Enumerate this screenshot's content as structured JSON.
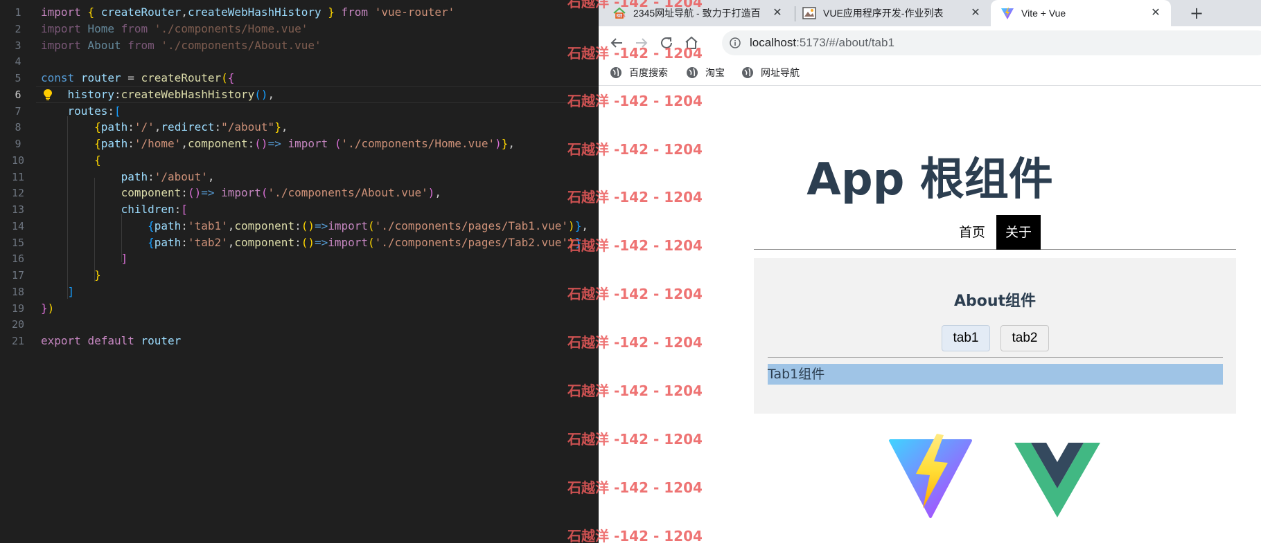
{
  "editor": {
    "active_line": 6,
    "lines": [
      {
        "n": "1",
        "tokens": [
          [
            "kw",
            "import"
          ],
          [
            "plain",
            " "
          ],
          [
            "br1",
            "{"
          ],
          [
            "plain",
            " "
          ],
          [
            "var",
            "createRouter"
          ],
          [
            "plain",
            ","
          ],
          [
            "var",
            "createWebHashHistory"
          ],
          [
            "plain",
            " "
          ],
          [
            "br1",
            "}"
          ],
          [
            "plain",
            " "
          ],
          [
            "kw",
            "from"
          ],
          [
            "plain",
            " "
          ],
          [
            "str",
            "'vue-router'"
          ]
        ]
      },
      {
        "n": "2",
        "tokens": [
          [
            "kw dim",
            "import"
          ],
          [
            "plain dim",
            " "
          ],
          [
            "var dim",
            "Home"
          ],
          [
            "plain dim",
            " "
          ],
          [
            "kw dim",
            "from"
          ],
          [
            "plain dim",
            " "
          ],
          [
            "str dim",
            "'./components/Home.vue'"
          ]
        ]
      },
      {
        "n": "3",
        "tokens": [
          [
            "kw dim",
            "import"
          ],
          [
            "plain dim",
            " "
          ],
          [
            "var dim",
            "About"
          ],
          [
            "plain dim",
            " "
          ],
          [
            "kw dim",
            "from"
          ],
          [
            "plain dim",
            " "
          ],
          [
            "str dim",
            "'./components/About.vue'"
          ]
        ]
      },
      {
        "n": "4",
        "tokens": []
      },
      {
        "n": "5",
        "tokens": [
          [
            "kw2",
            "const"
          ],
          [
            "plain",
            " "
          ],
          [
            "var",
            "router"
          ],
          [
            "plain",
            " = "
          ],
          [
            "fn",
            "createRouter"
          ],
          [
            "br1",
            "("
          ],
          [
            "br2",
            "{"
          ]
        ]
      },
      {
        "n": "6",
        "tokens": [
          [
            "plain",
            "    "
          ],
          [
            "prop",
            "history"
          ],
          [
            "plain",
            ":"
          ],
          [
            "fn",
            "createWebHashHistory"
          ],
          [
            "br3",
            "()"
          ],
          [
            "plain",
            ","
          ]
        ]
      },
      {
        "n": "7",
        "tokens": [
          [
            "plain",
            "    "
          ],
          [
            "prop",
            "routes"
          ],
          [
            "plain",
            ":"
          ],
          [
            "br3",
            "["
          ]
        ]
      },
      {
        "n": "8",
        "tokens": [
          [
            "plain",
            "        "
          ],
          [
            "br1",
            "{"
          ],
          [
            "prop",
            "path"
          ],
          [
            "plain",
            ":"
          ],
          [
            "str",
            "'/'"
          ],
          [
            "plain",
            ","
          ],
          [
            "prop",
            "redirect"
          ],
          [
            "plain",
            ":"
          ],
          [
            "str",
            "\"/about\""
          ],
          [
            "br1",
            "}"
          ],
          [
            "plain",
            ","
          ]
        ]
      },
      {
        "n": "9",
        "tokens": [
          [
            "plain",
            "        "
          ],
          [
            "br1",
            "{"
          ],
          [
            "prop",
            "path"
          ],
          [
            "plain",
            ":"
          ],
          [
            "str",
            "'/home'"
          ],
          [
            "plain",
            ","
          ],
          [
            "fn",
            "component"
          ],
          [
            "plain",
            ":"
          ],
          [
            "br2",
            "()"
          ],
          [
            "kw2",
            "=>"
          ],
          [
            "plain",
            " "
          ],
          [
            "kw",
            "import"
          ],
          [
            "plain",
            " "
          ],
          [
            "br2",
            "("
          ],
          [
            "str",
            "'./components/Home.vue'"
          ],
          [
            "br2",
            ")"
          ],
          [
            "br1",
            "}"
          ],
          [
            "plain",
            ","
          ]
        ]
      },
      {
        "n": "10",
        "tokens": [
          [
            "plain",
            "        "
          ],
          [
            "br1",
            "{"
          ]
        ]
      },
      {
        "n": "11",
        "tokens": [
          [
            "plain",
            "            "
          ],
          [
            "prop",
            "path"
          ],
          [
            "plain",
            ":"
          ],
          [
            "str",
            "'/about'"
          ],
          [
            "plain",
            ","
          ]
        ]
      },
      {
        "n": "12",
        "tokens": [
          [
            "plain",
            "            "
          ],
          [
            "fn",
            "component"
          ],
          [
            "plain",
            ":"
          ],
          [
            "br2",
            "()"
          ],
          [
            "kw2",
            "=>"
          ],
          [
            "plain",
            " "
          ],
          [
            "kw",
            "import"
          ],
          [
            "br2",
            "("
          ],
          [
            "str",
            "'./components/About.vue'"
          ],
          [
            "br2",
            ")"
          ],
          [
            "plain",
            ","
          ]
        ]
      },
      {
        "n": "13",
        "tokens": [
          [
            "plain",
            "            "
          ],
          [
            "prop",
            "children"
          ],
          [
            "plain",
            ":"
          ],
          [
            "br2",
            "["
          ]
        ]
      },
      {
        "n": "14",
        "tokens": [
          [
            "plain",
            "                "
          ],
          [
            "br3",
            "{"
          ],
          [
            "prop",
            "path"
          ],
          [
            "plain",
            ":"
          ],
          [
            "str",
            "'tab1'"
          ],
          [
            "plain",
            ","
          ],
          [
            "fn",
            "component"
          ],
          [
            "plain",
            ":"
          ],
          [
            "br1",
            "()"
          ],
          [
            "kw2",
            "=>"
          ],
          [
            "kw",
            "import"
          ],
          [
            "br1",
            "("
          ],
          [
            "str",
            "'./components/pages/Tab1.vue'"
          ],
          [
            "br1",
            ")"
          ],
          [
            "br3",
            "}"
          ],
          [
            "plain",
            ","
          ]
        ]
      },
      {
        "n": "15",
        "tokens": [
          [
            "plain",
            "                "
          ],
          [
            "br3",
            "{"
          ],
          [
            "prop",
            "path"
          ],
          [
            "plain",
            ":"
          ],
          [
            "str",
            "'tab2'"
          ],
          [
            "plain",
            ","
          ],
          [
            "fn",
            "component"
          ],
          [
            "plain",
            ":"
          ],
          [
            "br1",
            "()"
          ],
          [
            "kw2",
            "=>"
          ],
          [
            "kw",
            "import"
          ],
          [
            "br1",
            "("
          ],
          [
            "str",
            "'./components/pages/Tab2.vue'"
          ],
          [
            "br1",
            ")"
          ],
          [
            "br3",
            "}"
          ]
        ]
      },
      {
        "n": "16",
        "tokens": [
          [
            "plain",
            "            "
          ],
          [
            "br2",
            "]"
          ]
        ]
      },
      {
        "n": "17",
        "tokens": [
          [
            "plain",
            "        "
          ],
          [
            "br1",
            "}"
          ]
        ]
      },
      {
        "n": "18",
        "tokens": [
          [
            "plain",
            "    "
          ],
          [
            "br3",
            "]"
          ]
        ]
      },
      {
        "n": "19",
        "tokens": [
          [
            "br2",
            "}"
          ],
          [
            "br1",
            ")"
          ]
        ]
      },
      {
        "n": "20",
        "tokens": []
      },
      {
        "n": "21",
        "tokens": [
          [
            "kw",
            "export"
          ],
          [
            "plain",
            " "
          ],
          [
            "kw",
            "default"
          ],
          [
            "plain",
            " "
          ],
          [
            "var",
            "router"
          ]
        ]
      }
    ]
  },
  "browser": {
    "tabs": [
      {
        "title": "2345网址导航 - 致力于打造百",
        "close": "✕"
      },
      {
        "title": "VUE应用程序开发-作业列表",
        "close": "✕"
      },
      {
        "title": "Vite + Vue",
        "close": "✕"
      }
    ],
    "new_tab": "+",
    "url_host": "localhost",
    "url_path": ":5173/#/about/tab1",
    "bookmarks": [
      "百度搜索",
      "淘宝",
      "网址导航"
    ]
  },
  "page": {
    "app_title": "App 根组件",
    "nav": {
      "home": "首页",
      "about": "关于"
    },
    "about_title": "About组件",
    "tab1_btn": "tab1",
    "tab2_btn": "tab2",
    "tab_content": "Tab1组件"
  },
  "watermark": "石越洋 -142 - 1204",
  "colors": {
    "editor_bg": "#1f1f1f",
    "vue_green": "#41b883",
    "vue_dark": "#34495e",
    "active_nav": "#000000",
    "tab_panel": "#9fc4e6",
    "watermark": "#eb5a5a"
  }
}
